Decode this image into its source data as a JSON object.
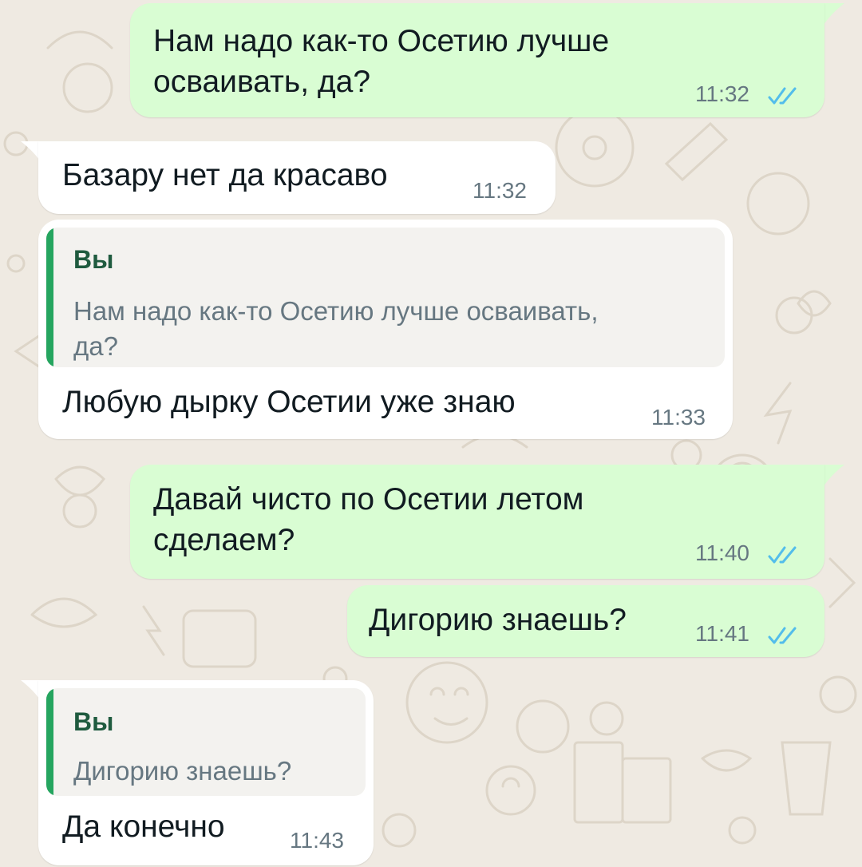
{
  "colors": {
    "outgoing_bubble": "#d9fdd3",
    "incoming_bubble": "#ffffff",
    "read_ticks": "#53bdeb",
    "quote_accent": "#25a55f",
    "background": "#efeae2"
  },
  "icons": {
    "read_receipt": "double-check-icon"
  },
  "messages": [
    {
      "direction": "outgoing",
      "lines": [
        "Нам надо как-то Осетию лучше",
        "осваивать, да?"
      ],
      "time": "11:32",
      "status": "read"
    },
    {
      "direction": "incoming",
      "text": "Базару нет да красаво",
      "time": "11:32"
    },
    {
      "direction": "incoming",
      "reply_to": {
        "author": "Вы",
        "lines": [
          "Нам надо как-то Осетию лучше осваивать,",
          "да?"
        ]
      },
      "text": "Любую дырку Осетии уже знаю",
      "time": "11:33"
    },
    {
      "direction": "outgoing",
      "lines": [
        "Давай чисто по Осетии летом",
        "сделаем?"
      ],
      "time": "11:40",
      "status": "read"
    },
    {
      "direction": "outgoing",
      "text": "Дигорию знаешь?",
      "time": "11:41",
      "status": "read"
    },
    {
      "direction": "incoming",
      "reply_to": {
        "author": "Вы",
        "text": "Дигорию знаешь?"
      },
      "text": "Да конечно",
      "time": "11:43"
    }
  ]
}
